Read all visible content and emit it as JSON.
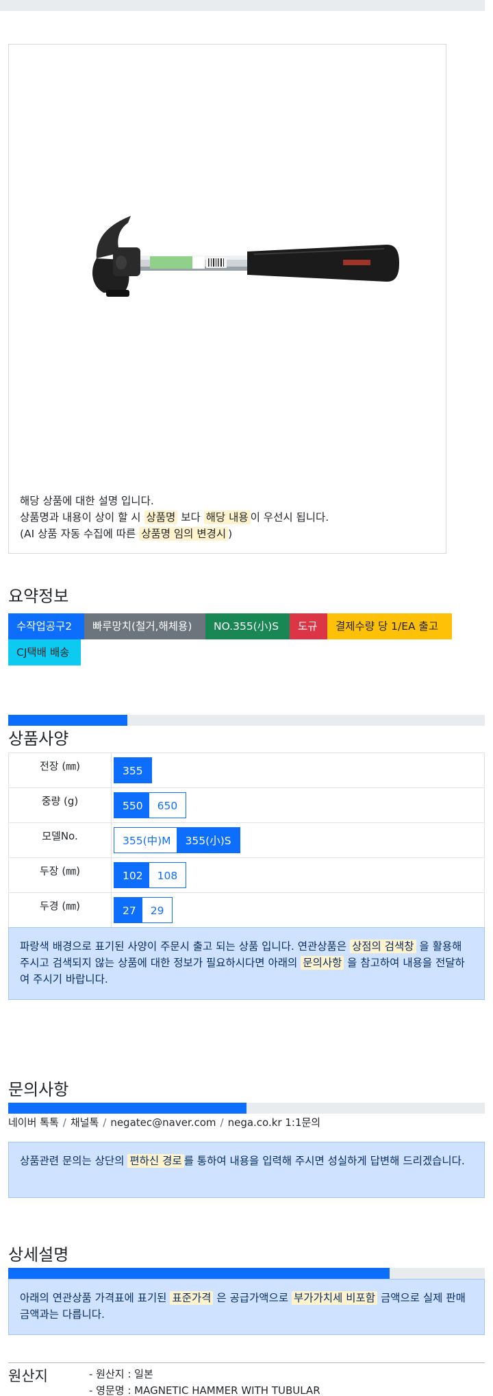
{
  "product_notes": {
    "line1": "해당 상품에 대한 설명 입니다.",
    "line2_a": "상품명과 내용이 상이 할 시 ",
    "line2_hl1": "상품명",
    "line2_b": " 보다 ",
    "line2_hl2": "해당 내용",
    "line2_c": "이 우선시 됩니다.",
    "line3_a": "(AI 상품 자동 수집에 따른 ",
    "line3_hl": "상품명 임의 변경시",
    "line3_b": ")"
  },
  "summary": {
    "title": "요약정보",
    "badges": [
      {
        "label": "수작업공구2",
        "color": "#0d6efd"
      },
      {
        "label": "빠루망치(철거,해체용)",
        "color": "#6c757d"
      },
      {
        "label": "NO.355(小)S",
        "color": "#198754"
      },
      {
        "label": "도규",
        "color": "#dc3545"
      },
      {
        "label": "결제수량 당 1/EA 출고",
        "color": "#ffc107"
      },
      {
        "label": "CJ택배 배송",
        "color": "#0dcaf0"
      }
    ]
  },
  "spec": {
    "title": "상품사양",
    "progress_fraction": 0.25,
    "rows": [
      {
        "label": "전장 (㎜)",
        "options": [
          {
            "v": "355",
            "selected": true
          }
        ]
      },
      {
        "label": "중량 (g)",
        "options": [
          {
            "v": "550",
            "selected": true
          },
          {
            "v": "650",
            "selected": false
          }
        ]
      },
      {
        "label": "모델No.",
        "options": [
          {
            "v": "355(中)M",
            "selected": false
          },
          {
            "v": "355(小)S",
            "selected": true
          }
        ]
      },
      {
        "label": "두장 (㎜)",
        "options": [
          {
            "v": "102",
            "selected": true
          },
          {
            "v": "108",
            "selected": false
          }
        ]
      },
      {
        "label": "두경 (㎜)",
        "options": [
          {
            "v": "27",
            "selected": true
          },
          {
            "v": "29",
            "selected": false
          }
        ]
      }
    ],
    "notice_a": "파랑색 배경으로 표기된 사양이 주문시 출고 되는 상품 입니다. 연관상품은 ",
    "notice_hl1": "상점의 검색창",
    "notice_b": " 을 활용해 주시고 검색되지 않는 상품에 대한 정보가 필요하시다면 아래의 ",
    "notice_hl2": "문의사항",
    "notice_c": " 을 참고하여 내용을 전달하여 주시기 바랍니다."
  },
  "inquiry": {
    "title": "문의사항",
    "progress_fraction": 0.5,
    "contacts": [
      "네이버 톡톡",
      "채널톡",
      "negatec@naver.com",
      "nega.co.kr 1:1문의"
    ],
    "notice_a": "상품관련 문의는 상단의 ",
    "notice_hl": "편하신 경로",
    "notice_b": "를 통하여 내용을 입력해 주시면 성실하게 답변해 드리겠습니다."
  },
  "detail": {
    "title": "상세설명",
    "progress_fraction": 0.8,
    "notice_a": "아래의 연관상품 가격표에 표기된 ",
    "notice_hl1": "표준가격",
    "notice_b": " 은 공급가액으로 ",
    "notice_hl2": "부가가치세 비포함",
    "notice_c": " 금액으로 실제 판매금액과는 다릅니다."
  },
  "origin": {
    "label": "원산지",
    "items": [
      "- 원산지 : 일본",
      "- 영문명 : MAGNETIC HAMMER WITH TUBULAR"
    ]
  }
}
